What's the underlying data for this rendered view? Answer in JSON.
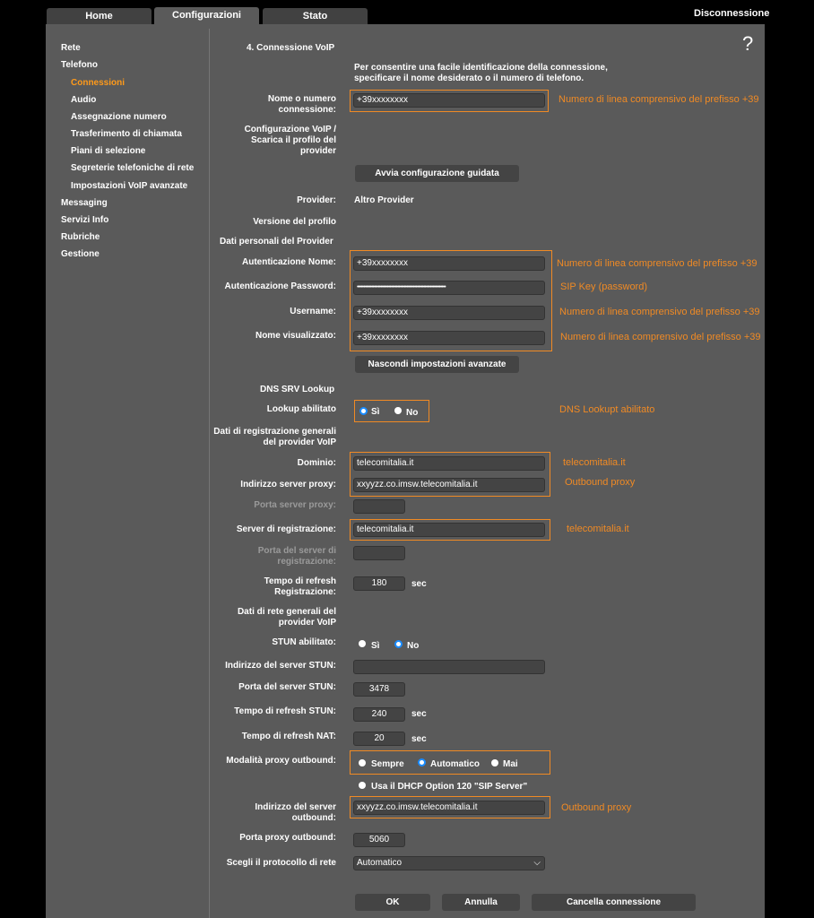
{
  "tabs": [
    {
      "label": "Home"
    },
    {
      "label": "Configurazioni"
    },
    {
      "label": "Stato"
    }
  ],
  "disconnect": "Disconnessione",
  "help": "?",
  "sidebar": {
    "items": [
      {
        "label": "Rete"
      },
      {
        "label": "Telefono"
      },
      {
        "label": "Connessioni"
      },
      {
        "label": "Audio"
      },
      {
        "label": "Assegnazione numero"
      },
      {
        "label": "Trasferimento di chiamata"
      },
      {
        "label": "Piani di selezione"
      },
      {
        "label": "Segreterie telefoniche di rete"
      },
      {
        "label": "Impostazioni VoIP avanzate"
      },
      {
        "label": "Messaging"
      },
      {
        "label": "Servizi Info"
      },
      {
        "label": "Rubriche"
      },
      {
        "label": "Gestione"
      }
    ]
  },
  "form": {
    "title": "4. Connessione VoIP",
    "intro": "Per consentire una facile identificazione della connessione, specificare il nome desiderato o il numero di telefono.",
    "conn_name_label": "Nome o numero connessione:",
    "conn_name_value": "+39xxxxxxxx",
    "voip_config_label": "Configurazione VoIP / Scarica il profilo del provider",
    "wizard_button": "Avvia configurazione guidata",
    "provider_label": "Provider:",
    "provider_value": "Altro Provider",
    "profile_version_label": "Versione del profilo",
    "personal_data_title": "Dati personali del Provider",
    "auth_name_label": "Autenticazione Nome:",
    "auth_name_value": "+39xxxxxxxx",
    "auth_pwd_label": "Autenticazione Password:",
    "auth_pwd_value": "••••••••••••••••••••••••••••••••••••••••••••••••••••••••••••••••••••",
    "username_label": "Username:",
    "username_value": "+39xxxxxxxx",
    "display_name_label": "Nome visualizzato:",
    "display_name_value": "+39xxxxxxxx",
    "hide_advanced_button": "Nascondi impostazioni avanzate",
    "dns_srv_title": "DNS SRV Lookup",
    "lookup_label": "Lookup abilitato",
    "yes": "Sì",
    "no": "No",
    "reg_title": "Dati di registrazione generali del provider VoIP",
    "domain_label": "Dominio:",
    "domain_value": "telecomitalia.it",
    "proxy_addr_label": "Indirizzo server proxy:",
    "proxy_addr_value": "xxyyzz.co.imsw.telecomitalia.it",
    "proxy_port_label": "Porta server proxy:",
    "reg_server_label": "Server di registrazione:",
    "reg_server_value": "telecomitalia.it",
    "reg_port_label": "Porta del server di registrazione:",
    "refresh_label": "Tempo di refresh Registrazione:",
    "refresh_value": "180",
    "sec": "sec",
    "net_title": "Dati di rete generali del provider VoIP",
    "stun_enabled_label": "STUN abilitato:",
    "stun_addr_label": "Indirizzo del server STUN:",
    "stun_port_label": "Porta del server STUN:",
    "stun_port_value": "3478",
    "stun_refresh_label": "Tempo di refresh STUN:",
    "stun_refresh_value": "240",
    "nat_refresh_label": "Tempo di refresh NAT:",
    "nat_refresh_value": "20",
    "outbound_mode_label": "Modalità proxy outbound:",
    "mode_always": "Sempre",
    "mode_auto": "Automatico",
    "mode_never": "Mai",
    "dhcp_option": "Usa il DHCP Option 120 \"SIP Server\"",
    "outbound_addr_label": "Indirizzo del server outbound:",
    "outbound_addr_value": "xxyyzz.co.imsw.telecomitalia.it",
    "outbound_port_label": "Porta proxy outbound:",
    "outbound_port_value": "5060",
    "protocol_label": "Scegli il protocollo di rete",
    "protocol_value": "Automatico",
    "ok_button": "OK",
    "cancel_button": "Annulla",
    "delete_button": "Cancella connessione"
  },
  "notes": {
    "line_number": "Numero di linea comprensivo del prefisso +39",
    "sip_key": "SIP Key (password)",
    "dns_lookup": "DNS Lookupt abilitato",
    "domain": "telecomitalia.it",
    "outbound_proxy": "Outbound proxy",
    "reg_server": "telecomitalia.it"
  },
  "colors": {
    "accent": "#f08a24",
    "active_nav": "#ff9a1a",
    "panel": "#5a5a5a",
    "radio_on": "#1a8cff"
  }
}
